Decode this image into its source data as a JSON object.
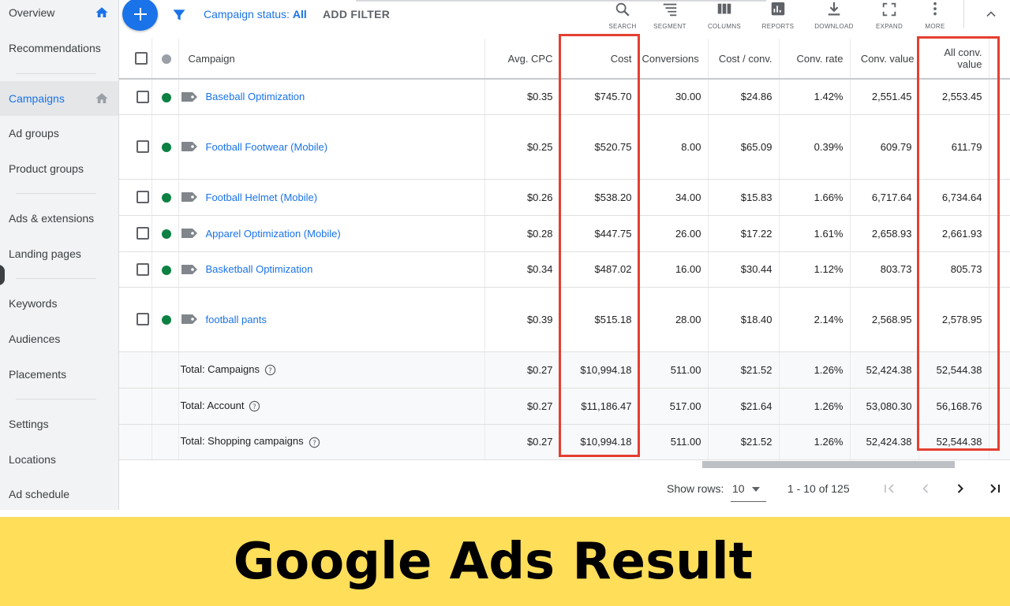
{
  "colors": {
    "accent": "#1a73e8",
    "enabled": "#0d8043",
    "highlight": "#e43f30",
    "banner": "#ffde59"
  },
  "sidebar": {
    "items": [
      {
        "label": "Overview",
        "icon": "home-icon"
      },
      {
        "label": "Recommendations"
      },
      {
        "label": "Campaigns",
        "icon": "home-icon",
        "active": true
      },
      {
        "label": "Ad groups"
      },
      {
        "label": "Product groups"
      },
      {
        "label": "Ads & extensions"
      },
      {
        "label": "Landing pages"
      },
      {
        "label": "Keywords"
      },
      {
        "label": "Audiences"
      },
      {
        "label": "Placements"
      },
      {
        "label": "Settings"
      },
      {
        "label": "Locations"
      },
      {
        "label": "Ad schedule"
      }
    ]
  },
  "toolbar": {
    "status_prefix": "Campaign status: ",
    "status_value": "All",
    "add_filter": "ADD FILTER",
    "tools": [
      {
        "label": "SEARCH",
        "icon": "search-icon"
      },
      {
        "label": "SEGMENT",
        "icon": "segment-icon"
      },
      {
        "label": "COLUMNS",
        "icon": "columns-icon"
      },
      {
        "label": "REPORTS",
        "icon": "reports-icon"
      },
      {
        "label": "DOWNLOAD",
        "icon": "download-icon"
      },
      {
        "label": "EXPAND",
        "icon": "expand-icon"
      },
      {
        "label": "MORE",
        "icon": "more-icon"
      }
    ]
  },
  "table": {
    "headers": [
      "Campaign",
      "Avg. CPC",
      "Cost",
      "Conversions",
      "Cost / conv.",
      "Conv. rate",
      "Conv. value",
      "All conv. value"
    ],
    "rows": [
      {
        "campaign": "Baseball Optimization",
        "cells": [
          "$0.35",
          "$745.70",
          "30.00",
          "$24.86",
          "1.42%",
          "2,551.45",
          "2,553.45"
        ]
      },
      {
        "campaign": "Football Footwear (Mobile)",
        "cells": [
          "$0.25",
          "$520.75",
          "8.00",
          "$65.09",
          "0.39%",
          "609.79",
          "611.79"
        ]
      },
      {
        "campaign": "Football Helmet (Mobile)",
        "cells": [
          "$0.26",
          "$538.20",
          "34.00",
          "$15.83",
          "1.66%",
          "6,717.64",
          "6,734.64"
        ]
      },
      {
        "campaign": "Apparel Optimization (Mobile)",
        "cells": [
          "$0.28",
          "$447.75",
          "26.00",
          "$17.22",
          "1.61%",
          "2,658.93",
          "2,661.93"
        ]
      },
      {
        "campaign": "Basketball Optimization",
        "cells": [
          "$0.34",
          "$487.02",
          "16.00",
          "$30.44",
          "1.12%",
          "803.73",
          "805.73"
        ]
      },
      {
        "campaign": "football pants",
        "cells": [
          "$0.39",
          "$515.18",
          "28.00",
          "$18.40",
          "2.14%",
          "2,568.95",
          "2,578.95"
        ]
      }
    ],
    "totals": [
      {
        "label": "Total: Campaigns",
        "cells": [
          "$0.27",
          "$10,994.18",
          "511.00",
          "$21.52",
          "1.26%",
          "52,424.38",
          "52,544.38"
        ]
      },
      {
        "label": "Total: Account",
        "cells": [
          "$0.27",
          "$11,186.47",
          "517.00",
          "$21.64",
          "1.26%",
          "53,080.30",
          "56,168.76"
        ]
      },
      {
        "label": "Total: Shopping campaigns",
        "cells": [
          "$0.27",
          "$10,994.18",
          "511.00",
          "$21.52",
          "1.26%",
          "52,424.38",
          "52,544.38"
        ]
      }
    ]
  },
  "pager": {
    "rows_label": "Show rows:",
    "rows_value": "10",
    "range": "1 - 10 of 125"
  },
  "banner": {
    "text": "Google Ads Result"
  }
}
